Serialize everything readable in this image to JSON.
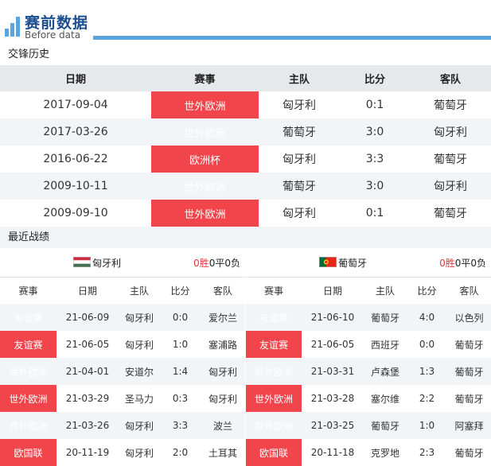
{
  "header": {
    "title": "赛前数据",
    "subtitle": "Before data",
    "accent": "#5aa4e0"
  },
  "h2h": {
    "section_title": "交锋历史",
    "columns": [
      "日期",
      "赛事",
      "主队",
      "比分",
      "客队"
    ],
    "rows": [
      {
        "date": "2017-09-04",
        "comp": "世外欧洲",
        "home": "匈牙利",
        "score": "0:1",
        "away": "葡萄牙"
      },
      {
        "date": "2017-03-26",
        "comp": "世外欧洲",
        "home": "葡萄牙",
        "score": "3:0",
        "away": "匈牙利"
      },
      {
        "date": "2016-06-22",
        "comp": "欧洲杯",
        "home": "匈牙利",
        "score": "3:3",
        "away": "葡萄牙"
      },
      {
        "date": "2009-10-11",
        "comp": "世外欧洲",
        "home": "葡萄牙",
        "score": "3:0",
        "away": "匈牙利"
      },
      {
        "date": "2009-09-10",
        "comp": "世外欧洲",
        "home": "匈牙利",
        "score": "0:1",
        "away": "葡萄牙"
      }
    ]
  },
  "recent": {
    "section_title": "最近战绩",
    "columns": [
      "赛事",
      "日期",
      "主队",
      "比分",
      "客队"
    ],
    "left": {
      "team": "匈牙利",
      "flag": "hungary-flag",
      "wins": "0胜",
      "draws": "0平",
      "losses": "0负",
      "rows": [
        {
          "comp": "友谊赛",
          "date": "21-06-09",
          "home": "匈牙利",
          "score": "0:0",
          "away": "爱尔兰"
        },
        {
          "comp": "友谊赛",
          "date": "21-06-05",
          "home": "匈牙利",
          "score": "1:0",
          "away": "塞浦路"
        },
        {
          "comp": "世外欧洲",
          "date": "21-04-01",
          "home": "安道尔",
          "score": "1:4",
          "away": "匈牙利"
        },
        {
          "comp": "世外欧洲",
          "date": "21-03-29",
          "home": "圣马力",
          "score": "0:3",
          "away": "匈牙利"
        },
        {
          "comp": "世外欧洲",
          "date": "21-03-26",
          "home": "匈牙利",
          "score": "3:3",
          "away": "波兰"
        },
        {
          "comp": "欧国联",
          "date": "20-11-19",
          "home": "匈牙利",
          "score": "2:0",
          "away": "土耳其"
        }
      ]
    },
    "right": {
      "team": "葡萄牙",
      "flag": "portugal-flag",
      "wins": "0胜",
      "draws": "0平",
      "losses": "0负",
      "rows": [
        {
          "comp": "友谊赛",
          "date": "21-06-10",
          "home": "葡萄牙",
          "score": "4:0",
          "away": "以色列"
        },
        {
          "comp": "友谊赛",
          "date": "21-06-05",
          "home": "西班牙",
          "score": "0:0",
          "away": "葡萄牙"
        },
        {
          "comp": "世外欧洲",
          "date": "21-03-31",
          "home": "卢森堡",
          "score": "1:3",
          "away": "葡萄牙"
        },
        {
          "comp": "世外欧洲",
          "date": "21-03-28",
          "home": "塞尔维",
          "score": "2:2",
          "away": "葡萄牙"
        },
        {
          "comp": "世外欧洲",
          "date": "21-03-25",
          "home": "葡萄牙",
          "score": "1:0",
          "away": "阿塞拜"
        },
        {
          "comp": "欧国联",
          "date": "20-11-18",
          "home": "克罗地",
          "score": "2:3",
          "away": "葡萄牙"
        }
      ]
    }
  }
}
